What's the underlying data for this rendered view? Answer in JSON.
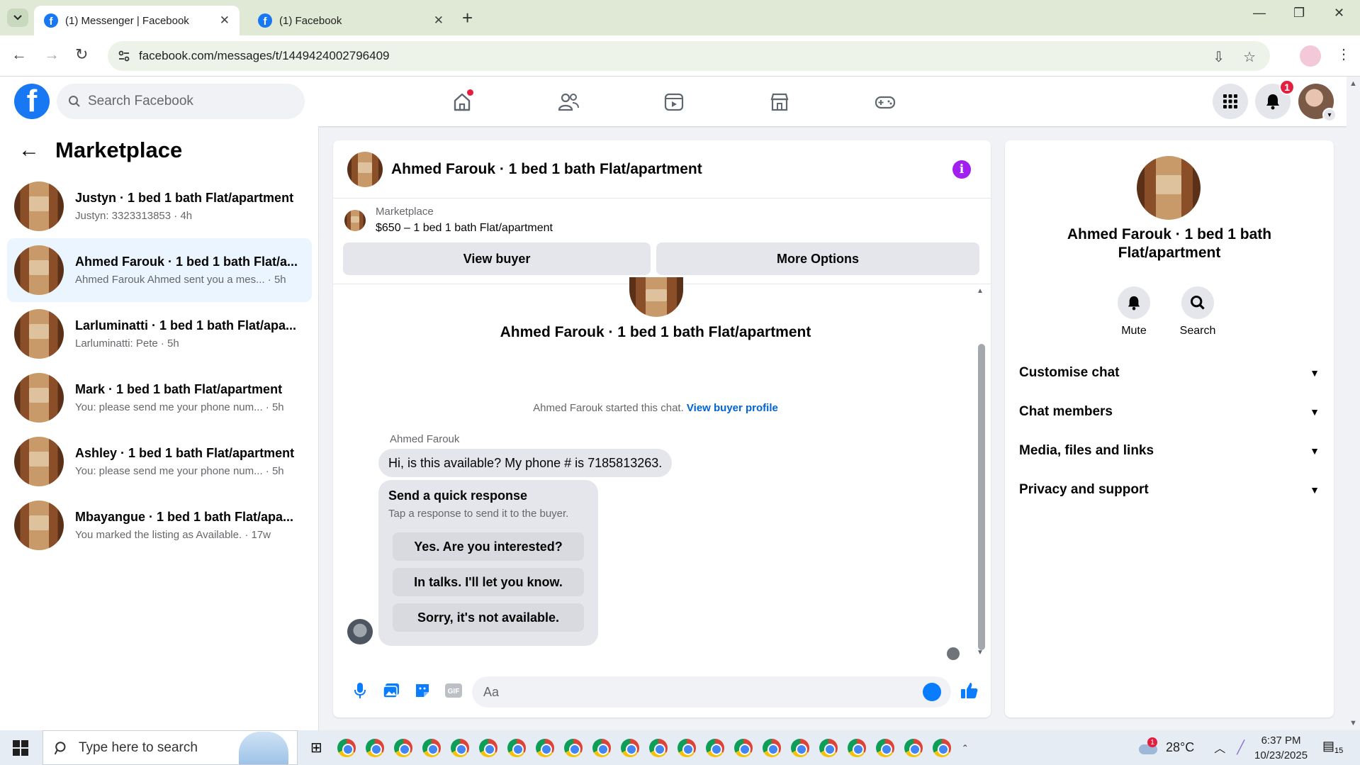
{
  "browser": {
    "tabs": [
      {
        "title": "(1) Messenger | Facebook",
        "active": true
      },
      {
        "title": "(1) Facebook",
        "active": false
      }
    ],
    "url": "facebook.com/messages/t/1449424002796409"
  },
  "fb_header": {
    "search_placeholder": "Search Facebook",
    "notification_count": "1"
  },
  "left": {
    "title": "Marketplace",
    "conversations": [
      {
        "name": "Justyn · 1 bed 1 bath Flat/apartment",
        "preview": "Justyn: 3323313853 · 4h"
      },
      {
        "name": "Ahmed Farouk · 1 bed 1 bath Flat/a...",
        "preview": "Ahmed Farouk Ahmed sent you a mes... · 5h"
      },
      {
        "name": "Larluminatti · 1 bed 1 bath Flat/apa...",
        "preview": "Larluminatti: Pete · 5h"
      },
      {
        "name": "Mark · 1 bed 1 bath Flat/apartment",
        "preview": "You: please send me your phone num... · 5h"
      },
      {
        "name": "Ashley · 1 bed 1 bath Flat/apartment",
        "preview": "You: please send me your phone num... · 5h"
      },
      {
        "name": "Mbayangue · 1 bed 1 bath Flat/apa...",
        "preview": "You marked the listing as Available. · 17w"
      }
    ]
  },
  "chat": {
    "header_name": "Ahmed Farouk · 1 bed 1 bath Flat/apartment",
    "listing_category": "Marketplace",
    "listing_price": "$650 – 1 bed 1 bath Flat/apartment",
    "view_buyer": "View buyer",
    "more_options": "More Options",
    "intro_name": "Ahmed Farouk · 1 bed 1 bath Flat/apartment",
    "started_text": "Ahmed Farouk started this chat.",
    "view_profile": "View buyer profile",
    "sender": "Ahmed Farouk",
    "message": "Hi, is this available? My phone # is 7185813263.",
    "quick_title": "Send a quick response",
    "quick_sub": "Tap a response to send it to the buyer.",
    "quick_replies": [
      "Yes. Are you interested?",
      "In talks. I'll let you know.",
      "Sorry, it's not available."
    ],
    "input_placeholder": "Aa"
  },
  "right": {
    "name": "Ahmed Farouk · 1 bed 1 bath Flat/apartment",
    "mute": "Mute",
    "search": "Search",
    "sections": [
      "Customise chat",
      "Chat members",
      "Media, files and links",
      "Privacy and support"
    ]
  },
  "taskbar": {
    "search_placeholder": "Type here to search",
    "temperature": "28°C",
    "weather_alert": "1",
    "time": "6:37 PM",
    "date": "10/23/2025",
    "notifications": "15"
  },
  "colors": {
    "facebook_blue": "#1877f2",
    "messenger_blue": "#0a7cff",
    "info_purple": "#a020f0",
    "notification_red": "#e41e3f"
  }
}
